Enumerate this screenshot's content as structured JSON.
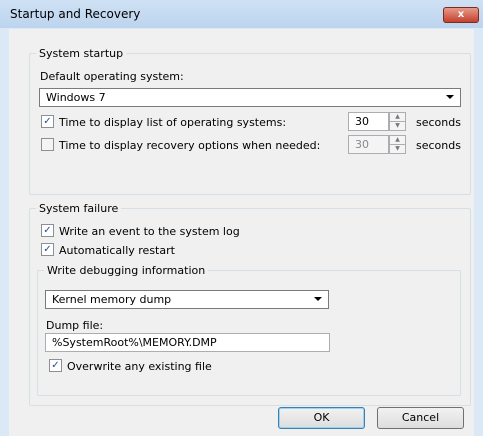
{
  "window": {
    "title": "Startup and Recovery",
    "close_label": "x"
  },
  "startup": {
    "group_title": "System startup",
    "default_os_label": "Default operating system:",
    "default_os_value": "Windows 7",
    "display_list": {
      "checked": true,
      "label": "Time to display list of operating systems:",
      "value": "30",
      "unit": "seconds"
    },
    "display_recovery": {
      "checked": false,
      "label": "Time to display recovery options when needed:",
      "value": "30",
      "unit": "seconds"
    }
  },
  "failure": {
    "group_title": "System failure",
    "write_event": {
      "checked": true,
      "label": "Write an event to the system log"
    },
    "auto_restart": {
      "checked": true,
      "label": "Automatically restart"
    },
    "debug": {
      "group_title": "Write debugging information",
      "dump_type": "Kernel memory dump",
      "dump_file_label": "Dump file:",
      "dump_file_value": "%SystemRoot%\\MEMORY.DMP",
      "overwrite": {
        "checked": true,
        "label": "Overwrite any existing file"
      }
    }
  },
  "buttons": {
    "ok": "OK",
    "cancel": "Cancel"
  }
}
